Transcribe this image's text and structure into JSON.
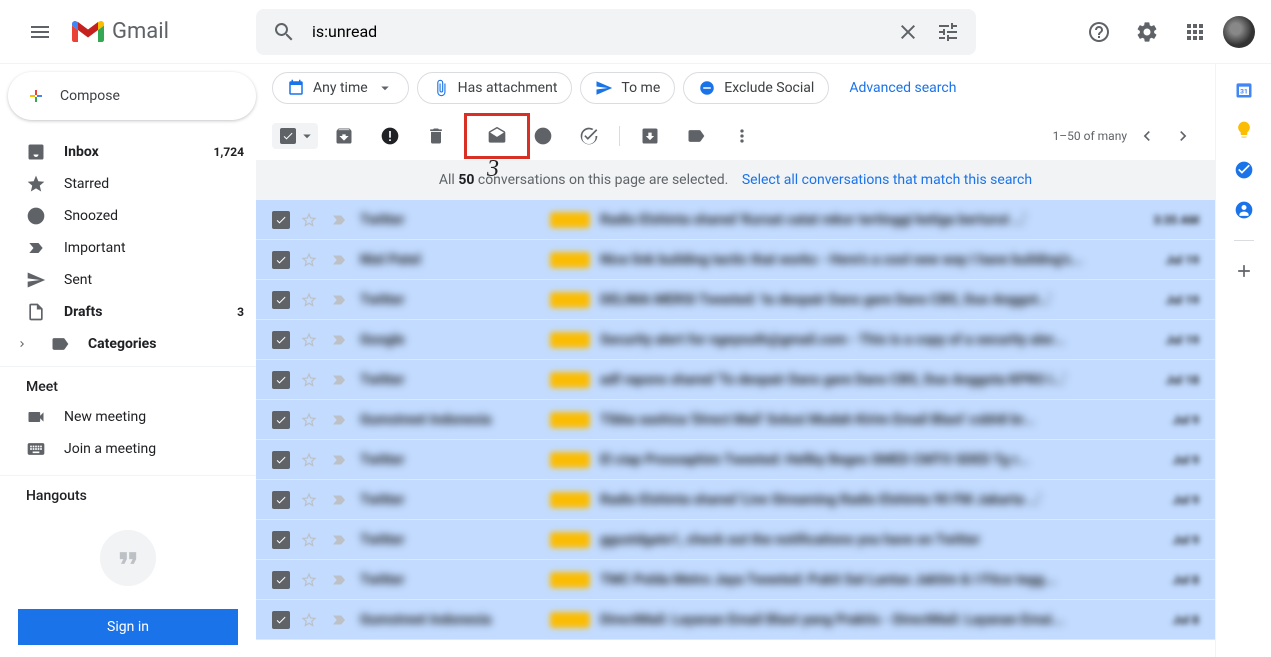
{
  "header": {
    "logo_text": "Gmail",
    "search_value": "is:unread"
  },
  "compose_label": "Compose",
  "nav": {
    "inbox": {
      "label": "Inbox",
      "count": "1,724"
    },
    "starred": {
      "label": "Starred"
    },
    "snoozed": {
      "label": "Snoozed"
    },
    "important": {
      "label": "Important"
    },
    "sent": {
      "label": "Sent"
    },
    "drafts": {
      "label": "Drafts",
      "count": "3"
    },
    "categories": {
      "label": "Categories"
    }
  },
  "meet": {
    "heading": "Meet",
    "new": "New meeting",
    "join": "Join a meeting"
  },
  "hangouts_heading": "Hangouts",
  "signin_label": "Sign in",
  "chips": {
    "anytime": "Any time",
    "attachment": "Has attachment",
    "tome": "To me",
    "exclude": "Exclude Social",
    "advanced": "Advanced search"
  },
  "toolbar": {
    "count_text": "1–50 of many"
  },
  "banner": {
    "prefix": "All ",
    "count": "50",
    "suffix": " conversations on this page are selected.",
    "link": "Select all conversations that match this search"
  },
  "annotation_3": "3",
  "rows": [
    {
      "sender": "Twitter",
      "subject": "Radio Elshinta shared 'Kursat catat rekor tertinggi ketiga berturut ...'",
      "date": "3:35 AM"
    },
    {
      "sender": "Niel Patel",
      "subject": "Nice link building tactic that works - Here's a cool new way I have building's...",
      "date": "Jul 19"
    },
    {
      "sender": "Twitter",
      "subject": "DELIMA MERSI Tweeted: 'to despair Dans gare Dans CBS, Duo Anggot...'",
      "date": "Jul 19"
    },
    {
      "sender": "Google",
      "subject": "Security alert for ngeyouth@gmail.com - This is a copy of a security aler...",
      "date": "Jul 19"
    },
    {
      "sender": "Twitter",
      "subject": "adf rapons shared 'To despair Dans gare Dans CBS, Duo Anggota KPRO i...'",
      "date": "Jul 18"
    },
    {
      "sender": "Gumstreet Indonesia",
      "subject": "Tibba xashiza 'Direct Mail' Solusi Mudah Kirim Email Blast' csbh8 br...",
      "date": "Jul 9"
    },
    {
      "sender": "Twitter",
      "subject": "El ciap Prosoaphim Tweeted: Hellby Beges SMED CMTO SDED Tg r...",
      "date": "Jul 9"
    },
    {
      "sender": "Twitter",
      "subject": "Radio Elshinta shared 'Live Streaming Radio Elshinta 90 FM Jakarta ...'",
      "date": "Jul 9"
    },
    {
      "sender": "Twitter",
      "subject": "ggustdgate1, check out the notifications you have on Twitter",
      "date": "Jul 9"
    },
    {
      "sender": "Twitter",
      "subject": "TMC Polda Metro Jaya Tweeted: Pukit Sat Lantas Jaktim & I Fitce tegg...",
      "date": "Jul 8"
    },
    {
      "sender": "Gumstreet Indonesia",
      "subject": "DirectMail: Layanan Email Blast yang Praktis - DirectMail: Layanan Emai...",
      "date": "Jul 8"
    }
  ]
}
